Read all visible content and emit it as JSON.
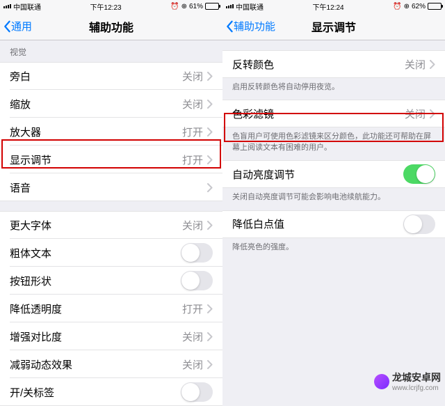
{
  "left": {
    "status": {
      "carrier": "中国联通",
      "time": "下午12:23",
      "battery_pct": "61%",
      "battery_fill": "61%"
    },
    "nav": {
      "back": "通用",
      "title": "辅助功能"
    },
    "section_header": "视觉",
    "rows": [
      {
        "label": "旁白",
        "value": "关闭",
        "type": "chevron"
      },
      {
        "label": "缩放",
        "value": "关闭",
        "type": "chevron"
      },
      {
        "label": "放大器",
        "value": "打开",
        "type": "chevron"
      },
      {
        "label": "显示调节",
        "value": "打开",
        "type": "chevron"
      },
      {
        "label": "语音",
        "value": "",
        "type": "chevron"
      },
      {
        "label": "更大字体",
        "value": "关闭",
        "type": "chevron"
      },
      {
        "label": "粗体文本",
        "value": "",
        "type": "toggle-off"
      },
      {
        "label": "按钮形状",
        "value": "",
        "type": "toggle-off"
      },
      {
        "label": "降低透明度",
        "value": "打开",
        "type": "chevron"
      },
      {
        "label": "增强对比度",
        "value": "关闭",
        "type": "chevron"
      },
      {
        "label": "减弱动态效果",
        "value": "关闭",
        "type": "chevron"
      },
      {
        "label": "开/关标签",
        "value": "",
        "type": "toggle-off"
      }
    ]
  },
  "right": {
    "status": {
      "carrier": "中国联通",
      "time": "下午12:24",
      "battery_pct": "62%",
      "battery_fill": "62%"
    },
    "nav": {
      "back": "辅助功能",
      "title": "显示调节"
    },
    "groups": [
      {
        "rows": [
          {
            "label": "反转颜色",
            "value": "关闭",
            "type": "chevron"
          }
        ],
        "footer": "启用反转颜色将自动停用夜览。"
      },
      {
        "rows": [
          {
            "label": "色彩滤镜",
            "value": "关闭",
            "type": "chevron"
          }
        ],
        "footer": "色盲用户可使用色彩滤镜来区分颜色，此功能还可帮助在屏幕上阅读文本有困难的用户。"
      },
      {
        "rows": [
          {
            "label": "自动亮度调节",
            "value": "",
            "type": "toggle-on"
          }
        ],
        "footer": "关闭自动亮度调节可能会影响电池续航能力。"
      },
      {
        "rows": [
          {
            "label": "降低白点值",
            "value": "",
            "type": "toggle-off"
          }
        ],
        "footer": "降低亮色的强度。"
      }
    ]
  },
  "watermark": {
    "name": "龙城安卓网",
    "url": "www.lcrjfg.com"
  }
}
